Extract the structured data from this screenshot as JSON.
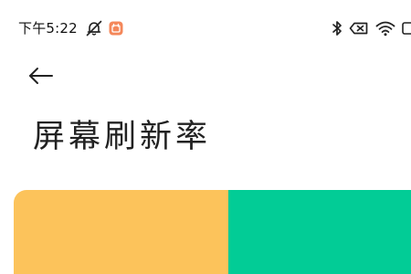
{
  "status_bar": {
    "time": "下午5:22",
    "left_icons": [
      "notifications-muted-icon",
      "app-notification-icon"
    ],
    "right_icons": [
      "bluetooth-icon",
      "battery-status-icon",
      "wifi-icon",
      "battery-icon"
    ]
  },
  "header": {
    "back_icon": "arrow-left-icon",
    "title": "屏幕刷新率"
  },
  "options": [
    {
      "color": "#FCC35B"
    },
    {
      "color": "#02CC96"
    }
  ],
  "colors": {
    "background": "#FFFFFF",
    "text": "#222222",
    "app_notification": "#F4875A"
  }
}
